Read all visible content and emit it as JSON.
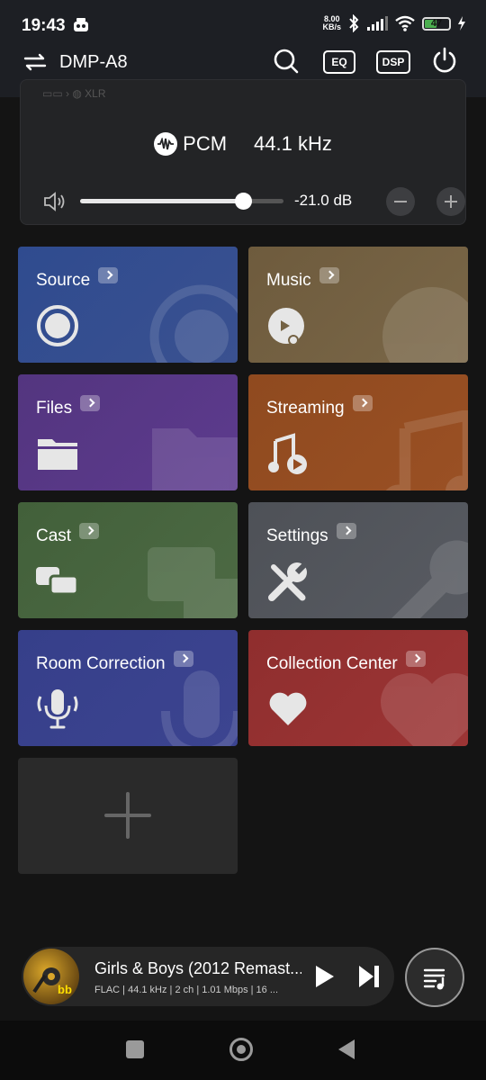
{
  "status": {
    "time": "19:43",
    "net_speed_value": "8.00",
    "net_speed_unit": "KB/s",
    "battery": "47"
  },
  "appbar": {
    "device_name": "DMP-A8",
    "eq_label": "EQ",
    "dsp_label": "DSP"
  },
  "device_card": {
    "output_hint": "XLR",
    "format": "PCM",
    "sample_rate": "44.1 kHz",
    "volume_db": "-21.0 dB",
    "volume_level": 0.8
  },
  "tiles": [
    {
      "label": "Source",
      "color": "#34508f"
    },
    {
      "label": "Music",
      "color": "#746244"
    },
    {
      "label": "Files",
      "color": "#583887"
    },
    {
      "label": "Streaming",
      "color": "#954d22"
    },
    {
      "label": "Cast",
      "color": "#48653f"
    },
    {
      "label": "Settings",
      "color": "#53565c"
    },
    {
      "label": "Room Correction",
      "color": "#39418d"
    },
    {
      "label": "Collection Center",
      "color": "#963232"
    }
  ],
  "now_playing": {
    "title": "Girls & Boys (2012 Remast...",
    "meta": "FLAC | 44.1 kHz | 2 ch | 1.01 Mbps | 16 ..."
  }
}
